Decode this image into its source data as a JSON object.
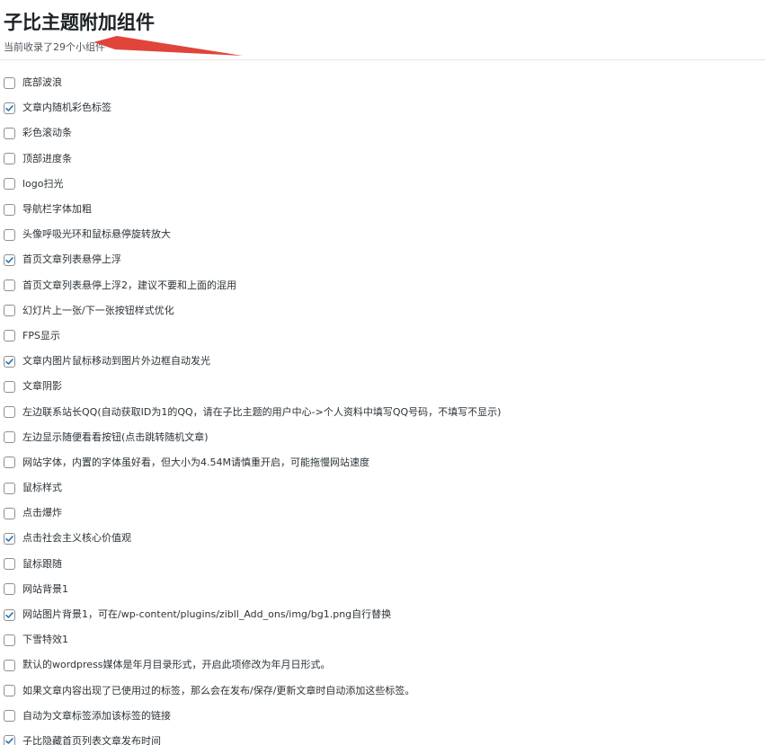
{
  "page": {
    "title": "子比主题附加组件",
    "subtitle": "当前收录了29个小组件",
    "accent_arrow_color": "#e0443a",
    "check_color": "#2271b1"
  },
  "options": [
    {
      "label": "底部波浪",
      "checked": false
    },
    {
      "label": "文章内随机彩色标签",
      "checked": true
    },
    {
      "label": "彩色滚动条",
      "checked": false
    },
    {
      "label": "顶部进度条",
      "checked": false
    },
    {
      "label": "logo扫光",
      "checked": false
    },
    {
      "label": "导航栏字体加粗",
      "checked": false
    },
    {
      "label": "头像呼吸光环和鼠标悬停旋转放大",
      "checked": false
    },
    {
      "label": "首页文章列表悬停上浮",
      "checked": true
    },
    {
      "label": "首页文章列表悬停上浮2，建议不要和上面的混用",
      "checked": false
    },
    {
      "label": "幻灯片上一张/下一张按钮样式优化",
      "checked": false
    },
    {
      "label": "FPS显示",
      "checked": false
    },
    {
      "label": "文章内图片鼠标移动到图片外边框自动发光",
      "checked": true
    },
    {
      "label": "文章阴影",
      "checked": false
    },
    {
      "label": "左边联系站长QQ(自动获取ID为1的QQ，请在子比主题的用户中心->个人资料中填写QQ号码，不填写不显示)",
      "checked": false
    },
    {
      "label": "左边显示随便看看按钮(点击跳转随机文章)",
      "checked": false
    },
    {
      "label": "网站字体，内置的字体虽好看，但大小为4.54M请慎重开启，可能拖慢网站速度",
      "checked": false
    },
    {
      "label": "鼠标样式",
      "checked": false
    },
    {
      "label": "点击爆炸",
      "checked": false
    },
    {
      "label": "点击社会主义核心价值观",
      "checked": true
    },
    {
      "label": "鼠标跟随",
      "checked": false
    },
    {
      "label": "网站背景1",
      "checked": false
    },
    {
      "label": "网站图片背景1，可在/wp-content/plugins/zibll_Add_ons/img/bg1.png自行替换",
      "checked": true
    },
    {
      "label": "下雪特效1",
      "checked": false
    },
    {
      "label": "默认的wordpress媒体是年月目录形式，开启此项修改为年月日形式。",
      "checked": false
    },
    {
      "label": "如果文章内容出现了已使用过的标签，那么会在发布/保存/更新文章时自动添加这些标签。",
      "checked": false
    },
    {
      "label": "自动为文章标签添加该标签的链接",
      "checked": false
    },
    {
      "label": "子比隐藏首页列表文章发布时间",
      "checked": true
    }
  ]
}
